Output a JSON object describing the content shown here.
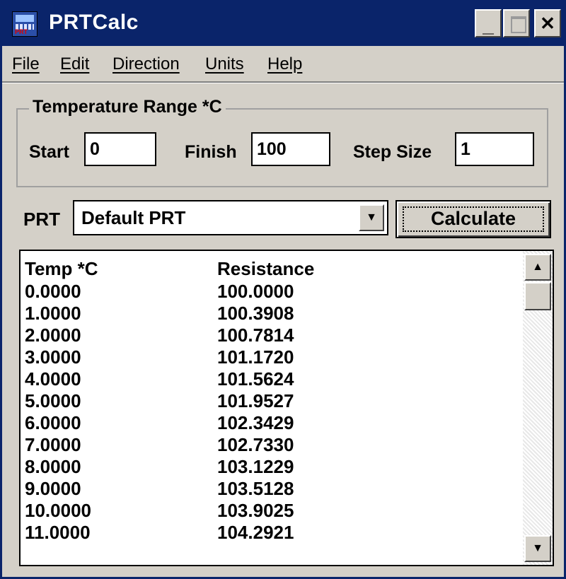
{
  "window": {
    "title": "PRTCalc",
    "icon_label": "PRT",
    "controls": {
      "minimize": "_",
      "close": "✕"
    }
  },
  "menu": [
    {
      "label": "File"
    },
    {
      "label": "Edit"
    },
    {
      "label": "Direction"
    },
    {
      "label": "Units"
    },
    {
      "label": "Help"
    }
  ],
  "temperature_range": {
    "title": "Temperature Range *C",
    "start_label": "Start",
    "start_value": "0",
    "finish_label": "Finish",
    "finish_value": "100",
    "step_label": "Step Size",
    "step_value": "1"
  },
  "prt": {
    "label": "PRT",
    "selected": "Default PRT",
    "calculate_label": "Calculate"
  },
  "results": {
    "headers": [
      "Temp *C",
      "Resistance"
    ],
    "rows": [
      [
        "0.0000",
        "100.0000"
      ],
      [
        "1.0000",
        "100.3908"
      ],
      [
        "2.0000",
        "100.7814"
      ],
      [
        "3.0000",
        "101.1720"
      ],
      [
        "4.0000",
        "101.5624"
      ],
      [
        "5.0000",
        "101.9527"
      ],
      [
        "6.0000",
        "102.3429"
      ],
      [
        "7.0000",
        "102.7330"
      ],
      [
        "8.0000",
        "103.1229"
      ],
      [
        "9.0000",
        "103.5128"
      ],
      [
        "10.0000",
        "103.9025"
      ],
      [
        "11.0000",
        "104.2921"
      ]
    ]
  },
  "icons": {
    "app": "calculator-icon",
    "minimize": "minimize-icon",
    "maximize": "maximize-icon",
    "close": "close-icon",
    "dropdown": "chevron-down-icon",
    "scroll_up": "arrow-up-icon",
    "scroll_down": "arrow-down-icon"
  },
  "colors": {
    "titlebar": "#0a246a",
    "face": "#d4d0c8",
    "window_bg": "#ffffff"
  }
}
